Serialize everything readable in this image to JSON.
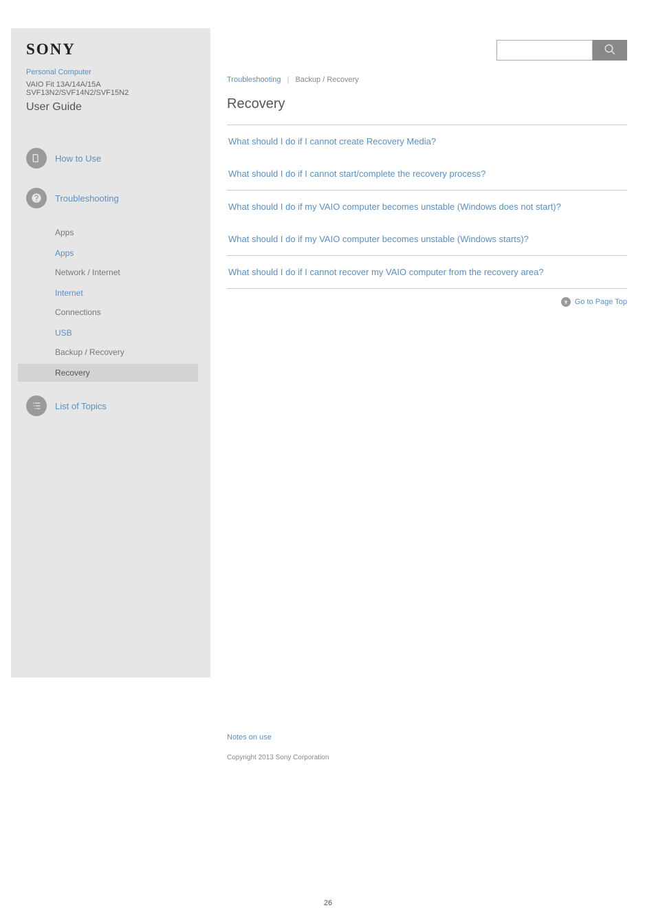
{
  "brand": "SONY",
  "product_link": "Personal Computer",
  "model": "VAIO Fit 13A/14A/15A SVF13N2/SVF14N2/SVF15N2",
  "guide_title": "User Guide",
  "search": {
    "placeholder": ""
  },
  "nav": {
    "how_to_use": "How to Use",
    "troubleshooting": "Troubleshooting",
    "apps_group": "Apps",
    "apps_link": "Apps",
    "network_group": "Network / Internet",
    "internet_link": "Internet",
    "connections_group": "Connections",
    "usb_link": "USB",
    "backup_group": "Backup / Recovery",
    "recovery_link": "Recovery",
    "list_of_topics": "List of Topics"
  },
  "breadcrumb": {
    "parent": "Troubleshooting",
    "current": "Backup / Recovery"
  },
  "page_title": "Recovery",
  "topics": [
    "What should I do if I cannot create Recovery Media?",
    "What should I do if I cannot start/complete the recovery process?",
    "What should I do if my VAIO computer becomes unstable (Windows does not start)?",
    "What should I do if my VAIO computer becomes unstable (Windows starts)?",
    "What should I do if I cannot recover my VAIO computer from the recovery area?"
  ],
  "gotop": "Go to Page Top",
  "footer": {
    "notes": "Notes on use",
    "copyright": "Copyright 2013 Sony Corporation"
  },
  "page_number": "26"
}
